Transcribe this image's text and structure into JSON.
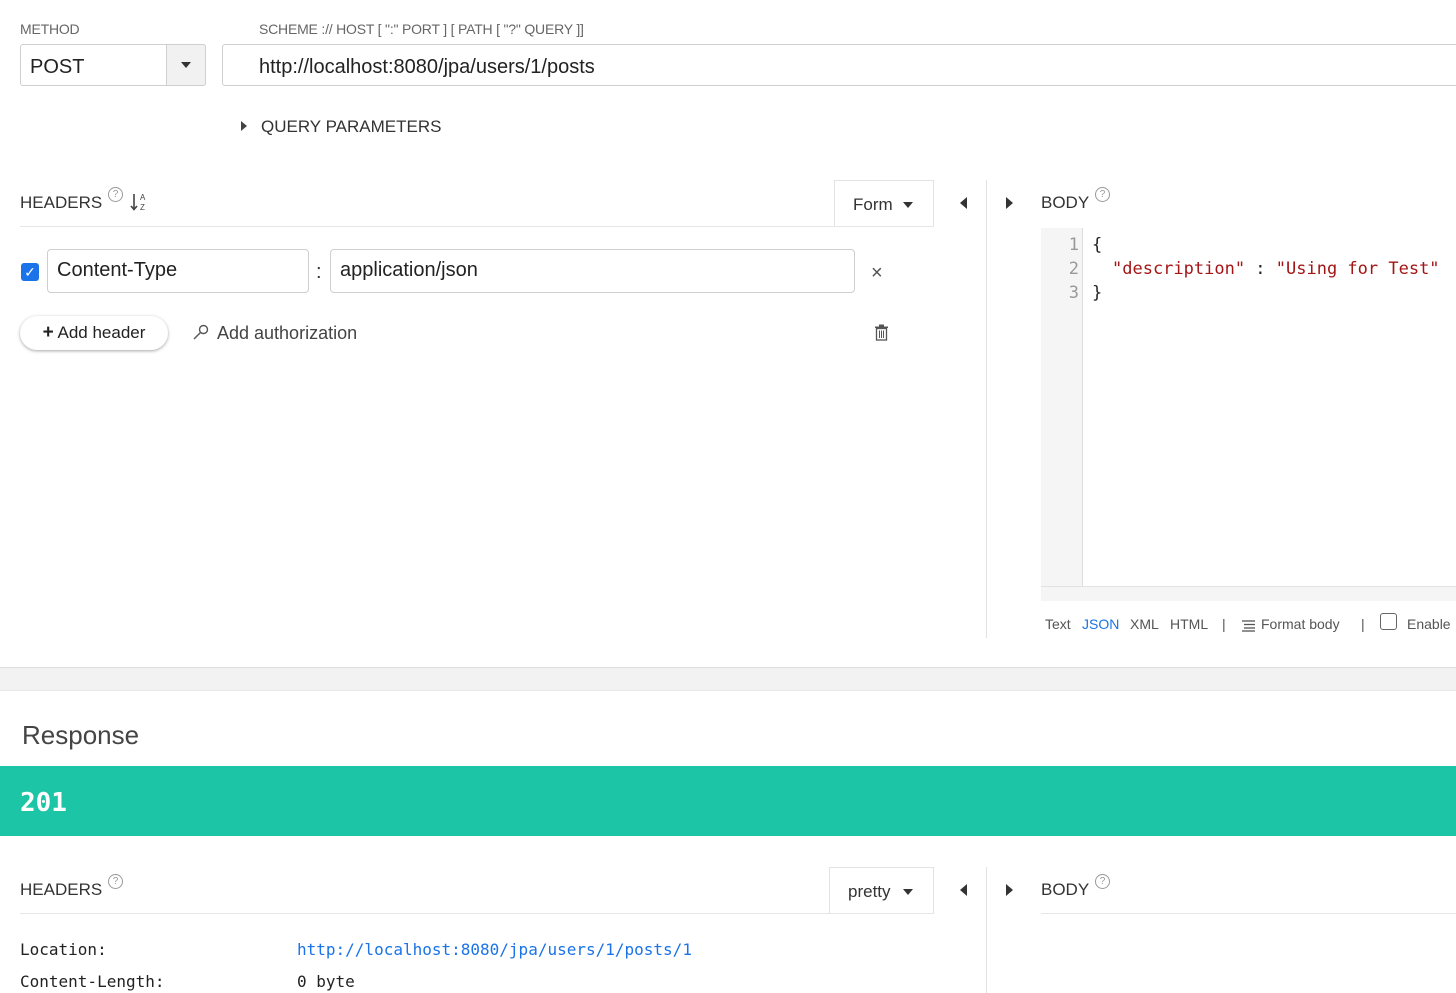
{
  "request": {
    "method_label": "METHOD",
    "method": "POST",
    "url_label": "SCHEME :// HOST [ \":\" PORT ] [ PATH [ \"?\" QUERY ]]",
    "url": "http://localhost:8080/jpa/users/1/posts",
    "query_parameters_label": "QUERY PARAMETERS"
  },
  "headers_panel": {
    "title": "HEADERS",
    "sort_icon": "sort-alpha-icon",
    "mode": "Form",
    "rows": [
      {
        "checked": true,
        "name": "Content-Type",
        "separator": ":",
        "value": "application/json"
      }
    ],
    "add_header_label": "Add header",
    "add_authorization_label": "Add authorization"
  },
  "body_panel": {
    "title": "BODY",
    "lines": [
      {
        "num": "1",
        "text": "{"
      },
      {
        "num": "2",
        "key": "\"description\"",
        "sep": " : ",
        "value": "\"Using for Test\""
      },
      {
        "num": "3",
        "text": "}"
      }
    ],
    "formats": [
      "Text",
      "JSON",
      "XML",
      "HTML"
    ],
    "active_format": "JSON",
    "divider": "|",
    "format_body_label": "Format body",
    "enable_label": "Enable"
  },
  "response": {
    "title": "Response",
    "status_code": "201",
    "status_color": "#1bc5a6",
    "headers_title": "HEADERS",
    "view_mode": "pretty",
    "body_title": "BODY",
    "header_rows": [
      {
        "key": "Location:",
        "value": "http://localhost:8080/jpa/users/1/posts/1",
        "is_link": true
      },
      {
        "key": "Content-Length:",
        "value": "0 byte",
        "is_link": false
      }
    ]
  },
  "colors": {
    "accent": "#1a73e8",
    "json_string": "#a31515"
  }
}
